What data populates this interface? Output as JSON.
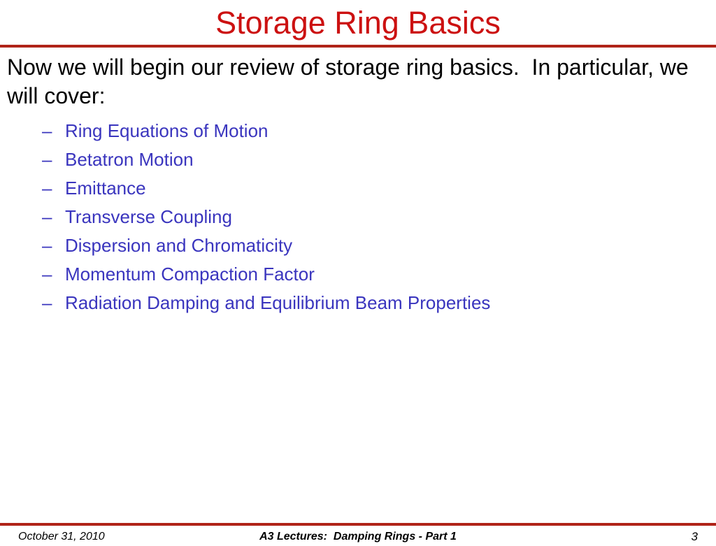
{
  "slide": {
    "title": "Storage Ring Basics",
    "title_color": "#CC1111",
    "rule_color": "#B02318",
    "bullet_color": "#3A35BE",
    "lead_text": "Now we will begin our review of storage ring basics.  In particular, we will cover:",
    "bullets": [
      {
        "marker": "–",
        "label": "Ring Equations of Motion"
      },
      {
        "marker": "–",
        "label": "Betatron Motion"
      },
      {
        "marker": "–",
        "label": "Emittance"
      },
      {
        "marker": "–",
        "label": "Transverse Coupling"
      },
      {
        "marker": "–",
        "label": "Dispersion and Chromaticity"
      },
      {
        "marker": "–",
        "label": "Momentum Compaction Factor"
      },
      {
        "marker": "–",
        "label": "Radiation Damping and Equilibrium Beam Properties"
      }
    ]
  },
  "footer": {
    "date": "October 31, 2010",
    "center": "A3 Lectures:  Damping Rings - Part 1",
    "page_number": "3"
  }
}
